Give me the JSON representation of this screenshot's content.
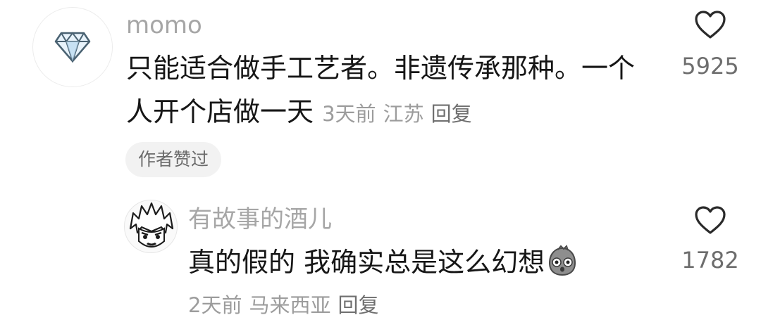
{
  "comment": {
    "username": "momo",
    "text_line1": "只能适合做手工艺者。非遗传承那种。一个",
    "text_line2": "人开个店做一天",
    "time": "3天前",
    "location": "江苏",
    "reply_label": "回复",
    "likes": "5925",
    "author_liked_badge": "作者赞过",
    "avatar_icon": "diamond-icon"
  },
  "reply": {
    "username": "有故事的酒儿",
    "text": "真的假的 我确实总是这么幻想",
    "emoji_icon": "shocked-face-emoji-icon",
    "time": "2天前",
    "location": "马来西亚",
    "reply_label": "回复",
    "likes": "1782",
    "avatar_icon": "anime-avatar-icon"
  },
  "colors": {
    "text_primary": "#161616",
    "text_secondary": "#9c9c9c",
    "badge_bg": "#f2f2f2"
  }
}
